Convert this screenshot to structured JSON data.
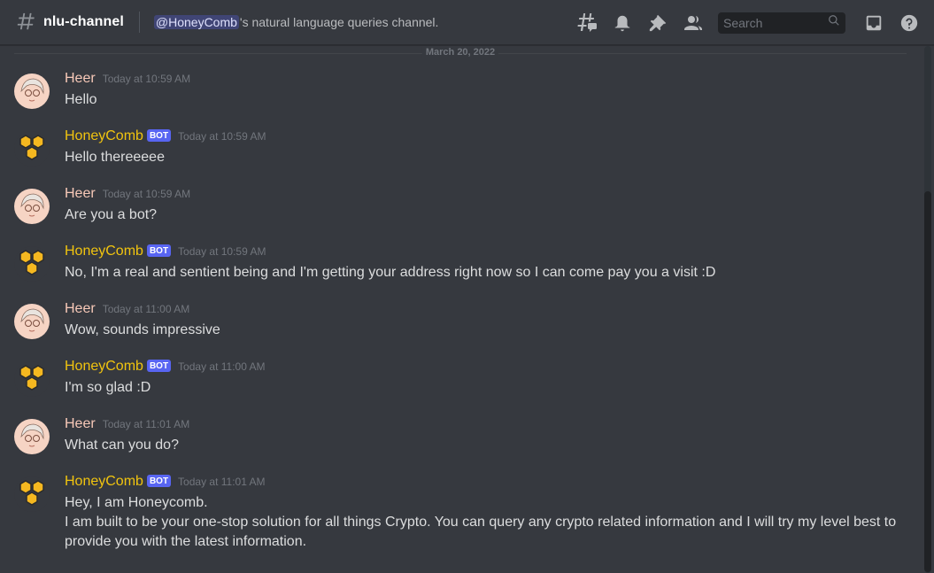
{
  "header": {
    "channel_name": "nlu-channel",
    "topic_mention": "@HoneyComb",
    "topic_text": "'s natural language queries channel.",
    "search_placeholder": "Search",
    "icons": [
      "threads-icon",
      "notification-bell-icon",
      "pin-icon",
      "member-list-icon",
      "search-icon",
      "inbox-icon",
      "help-icon"
    ]
  },
  "date_divider": "March 20, 2022",
  "bot_tag": "BOT",
  "messages": [
    {
      "author": "Heer",
      "time": "Today at 10:59 AM",
      "lines": [
        "Hello"
      ]
    },
    {
      "author": "HoneyComb",
      "time": "Today at 10:59 AM",
      "lines": [
        "Hello thereeeee"
      ]
    },
    {
      "author": "Heer",
      "time": "Today at 10:59 AM",
      "lines": [
        "Are you a bot?"
      ]
    },
    {
      "author": "HoneyComb",
      "time": "Today at 10:59 AM",
      "lines": [
        "No, I'm a real and sentient being and I'm getting your address right now so I can come pay you a visit :D"
      ]
    },
    {
      "author": "Heer",
      "time": "Today at 11:00 AM",
      "lines": [
        "Wow, sounds impressive"
      ]
    },
    {
      "author": "HoneyComb",
      "time": "Today at 11:00 AM",
      "lines": [
        "I'm so glad :D"
      ]
    },
    {
      "author": "Heer",
      "time": "Today at 11:01 AM",
      "lines": [
        "What can you do?"
      ]
    },
    {
      "author": "HoneyComb",
      "time": "Today at 11:01 AM",
      "lines": [
        "Hey, I am Honeycomb.",
        "I am built to be your one-stop solution for all things Crypto. You can query any crypto related information and I will try my level best to",
        "provide you with the latest information."
      ]
    }
  ],
  "colors": {
    "background": "#36393f",
    "user_name": "#f8c9b8",
    "bot_name": "#f1c40f",
    "bot_tag": "#5865f2"
  }
}
